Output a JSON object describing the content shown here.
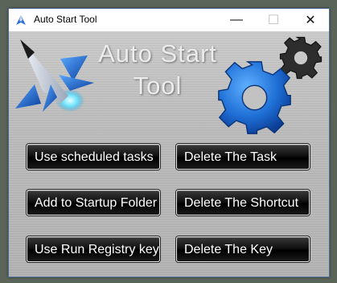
{
  "window": {
    "title": "Auto Start Tool",
    "controls": {
      "minimize": "—",
      "maximize": "☐",
      "close": "✕"
    }
  },
  "header": {
    "title_line1": "Auto Start",
    "title_line2": "Tool",
    "icons": [
      "rocket-icon",
      "gear-icon",
      "small-gear-icon"
    ]
  },
  "buttons": {
    "use_scheduled_tasks": "Use scheduled tasks",
    "delete_task": "Delete The Task",
    "add_startup_folder": "Add to Startup Folder",
    "delete_shortcut": "Delete The Shortcut",
    "use_run_registry": "Use Run Registry key",
    "delete_key": "Delete The Key"
  },
  "colors": {
    "button_bg": "#000000",
    "button_text": "#ffffff",
    "gear_blue": "#1f6fd6",
    "panel": "#bcbcbc"
  }
}
